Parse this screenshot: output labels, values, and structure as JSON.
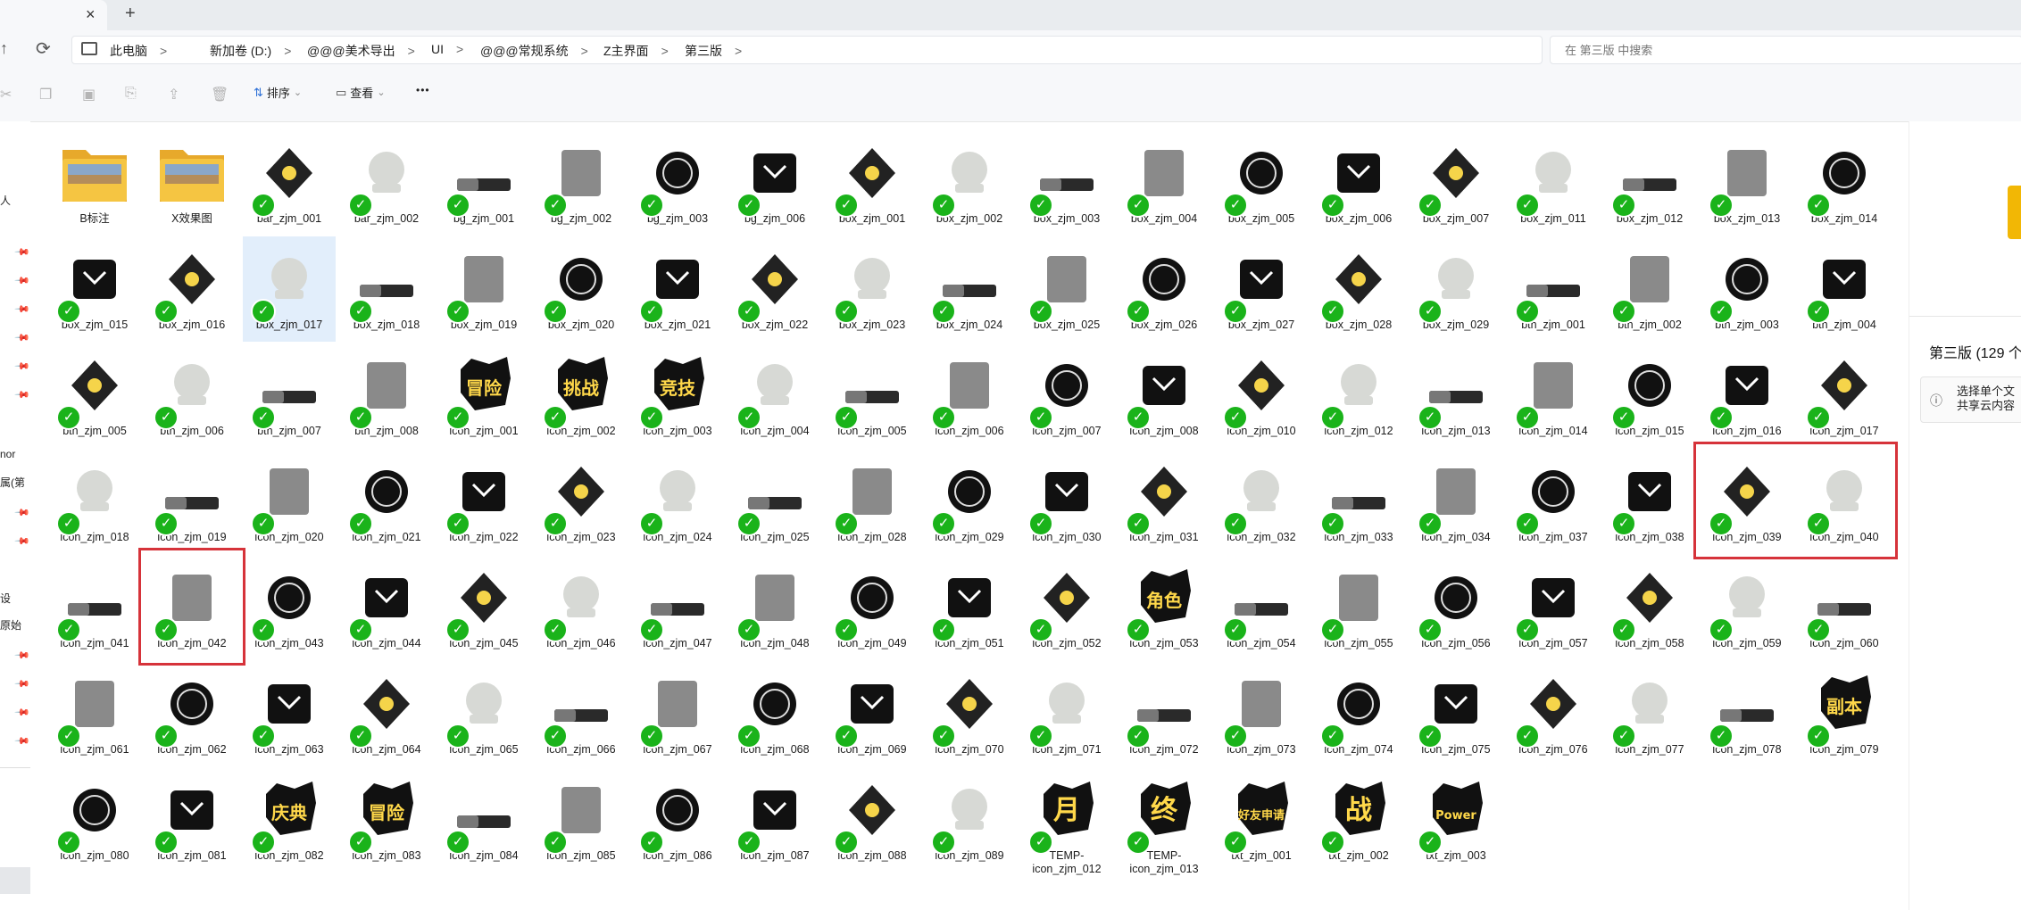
{
  "tab": {
    "close": "×",
    "new": "+"
  },
  "nav": {
    "up": "↑",
    "refresh": "⟳"
  },
  "breadcrumb": [
    {
      "label": "此电脑",
      "sep": ">"
    },
    {
      "label": "新加卷 (D:)",
      "sep": ">"
    },
    {
      "label": "@@@美术导出",
      "sep": ">"
    },
    {
      "label": "UI",
      "sep": ">"
    },
    {
      "label": "@@@常规系统",
      "sep": ">"
    },
    {
      "label": "Z主界面",
      "sep": ">"
    },
    {
      "label": "第三版",
      "sep": ">"
    }
  ],
  "search": {
    "placeholder": "在 第三版 中搜索"
  },
  "toolbar": {
    "sort_label": "排序",
    "view_label": "查看",
    "more": "•••",
    "caret": "⌄"
  },
  "sidebar": {
    "labels": [
      "人",
      "nor",
      "属(第",
      "设",
      "原始"
    ]
  },
  "details": {
    "count_text": "第三版 (129 个",
    "tip_line1": "选择单个文",
    "tip_line2": "共享云内容"
  },
  "files": [
    "B标注",
    "X效果图",
    "bar_zjm_001",
    "bar_zjm_002",
    "bg_zjm_001",
    "bg_zjm_002",
    "bg_zjm_003",
    "bg_zjm_006",
    "box_zjm_001",
    "box_zjm_002",
    "box_zjm_003",
    "box_zjm_004",
    "box_zjm_005",
    "box_zjm_006",
    "box_zjm_007",
    "box_zjm_011",
    "box_zjm_012",
    "box_zjm_013",
    "box_zjm_014",
    "box_zjm_015",
    "box_zjm_016",
    "box_zjm_017",
    "box_zjm_018",
    "box_zjm_019",
    "box_zjm_020",
    "box_zjm_021",
    "box_zjm_022",
    "box_zjm_023",
    "box_zjm_024",
    "box_zjm_025",
    "box_zjm_026",
    "box_zjm_027",
    "box_zjm_028",
    "box_zjm_029",
    "btn_zjm_001",
    "btn_zjm_002",
    "btn_zjm_003",
    "btn_zjm_004",
    "btn_zjm_005",
    "btn_zjm_006",
    "btn_zjm_007",
    "btn_zjm_008",
    "icon_zjm_001",
    "icon_zjm_002",
    "icon_zjm_003",
    "icon_zjm_004",
    "icon_zjm_005",
    "icon_zjm_006",
    "icon_zjm_007",
    "icon_zjm_008",
    "icon_zjm_010",
    "icon_zjm_012",
    "icon_zjm_013",
    "icon_zjm_014",
    "icon_zjm_015",
    "icon_zjm_016",
    "icon_zjm_017",
    "icon_zjm_018",
    "icon_zjm_019",
    "icon_zjm_020",
    "icon_zjm_021",
    "icon_zjm_022",
    "icon_zjm_023",
    "icon_zjm_024",
    "icon_zjm_025",
    "icon_zjm_028",
    "icon_zjm_029",
    "icon_zjm_030",
    "icon_zjm_031",
    "icon_zjm_032",
    "icon_zjm_033",
    "icon_zjm_034",
    "icon_zjm_037",
    "icon_zjm_038",
    "icon_zjm_039",
    "icon_zjm_040",
    "icon_zjm_041",
    "icon_zjm_042",
    "icon_zjm_043",
    "icon_zjm_044",
    "icon_zjm_045",
    "icon_zjm_046",
    "icon_zjm_047",
    "icon_zjm_048",
    "icon_zjm_049",
    "icon_zjm_051",
    "icon_zjm_052",
    "icon_zjm_053",
    "icon_zjm_054",
    "icon_zjm_055",
    "icon_zjm_056",
    "icon_zjm_057",
    "icon_zjm_058",
    "icon_zjm_059",
    "icon_zjm_060",
    "icon_zjm_061",
    "icon_zjm_062",
    "icon_zjm_063",
    "icon_zjm_064",
    "icon_zjm_065",
    "icon_zjm_066",
    "icon_zjm_067",
    "icon_zjm_068",
    "icon_zjm_069",
    "icon_zjm_070",
    "icon_zjm_071",
    "icon_zjm_072",
    "icon_zjm_073",
    "icon_zjm_074",
    "icon_zjm_075",
    "icon_zjm_076",
    "icon_zjm_077",
    "icon_zjm_078",
    "icon_zjm_079",
    "icon_zjm_080",
    "icon_zjm_081",
    "icon_zjm_082",
    "icon_zjm_083",
    "icon_zjm_084",
    "icon_zjm_085",
    "icon_zjm_086",
    "icon_zjm_087",
    "icon_zjm_088",
    "icon_zjm_089",
    "TEMP-icon_zjm_012",
    "TEMP-icon_zjm_013",
    "txt_zjm_001",
    "txt_zjm_002",
    "txt_zjm_003"
  ],
  "thumb_text": {
    "icon_zjm_001": "冒险",
    "icon_zjm_002": "挑战",
    "icon_zjm_003": "竞技",
    "icon_zjm_053": "角色",
    "icon_zjm_079": "副本",
    "icon_zjm_082": "庆典",
    "icon_zjm_083": "冒险",
    "TEMP-icon_zjm_012": "月",
    "TEMP-icon_zjm_013": "终",
    "txt_zjm_001": "好友申请",
    "txt_zjm_002": "战",
    "txt_zjm_003": "Power"
  },
  "selected_file": "box_zjm_017",
  "highlighted_groups": [
    [
      "icon_zjm_039",
      "icon_zjm_040"
    ],
    [
      "icon_zjm_042"
    ]
  ],
  "check_mark": "✓",
  "colors": {
    "check_green": "#1ab31a",
    "highlight_red": "#d6333a",
    "folder_yellow": "#f5c542",
    "selection_blue": "#e2eefb"
  }
}
